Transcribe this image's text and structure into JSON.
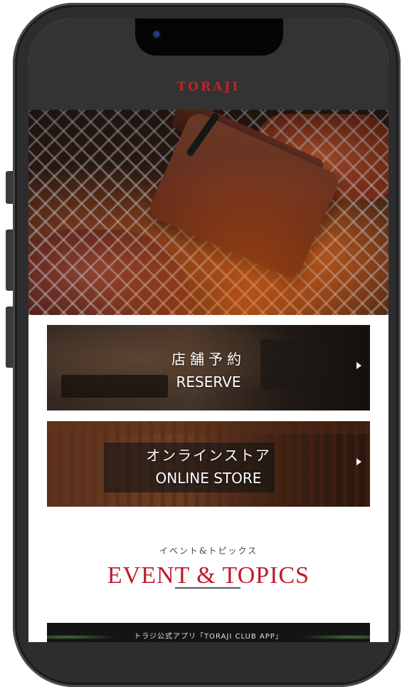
{
  "header": {
    "logo_text": "TORAJI"
  },
  "banners": [
    {
      "title_jp": "店舗予約",
      "title_en": "RESERVE"
    },
    {
      "title_jp": "オンラインストア",
      "title_en": "ONLINE STORE"
    }
  ],
  "topics": {
    "subtitle": "イベント&トピックス",
    "title": "EVENT & TOPICS",
    "first_card_text": "トラジ公式アプリ「TORAJI CLUB APP」"
  },
  "colors": {
    "header_bg": "#333333",
    "accent_red": "#c0192c",
    "frame": "#2d2d2f"
  }
}
